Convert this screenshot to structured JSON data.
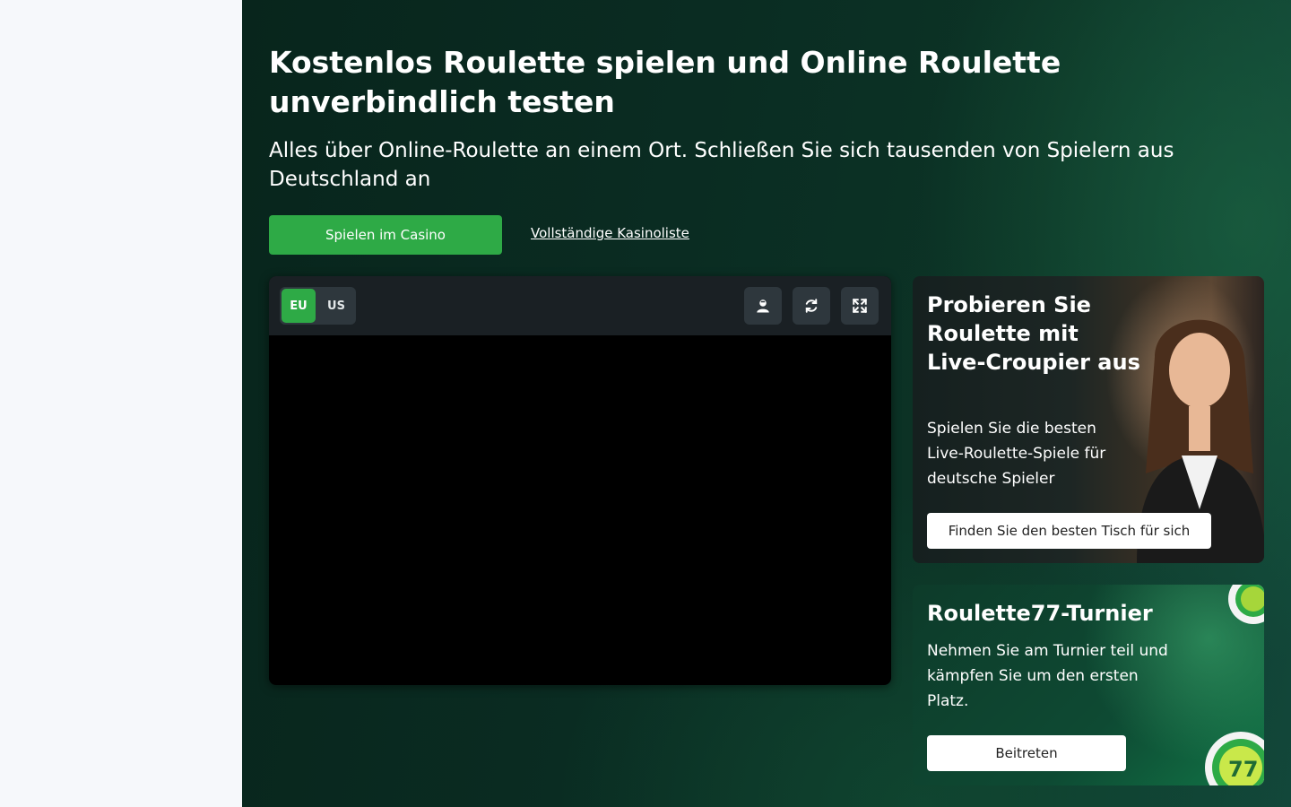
{
  "hero": {
    "title": "Kostenlos Roulette spielen und Online Roulette unverbindlich testen",
    "subtitle": "Alles über Online-Roulette an einem Ort. Schließen Sie sich tausenden von Spielern aus Deutschland an",
    "play_button": "Spielen im Casino",
    "list_link": "Vollständige Kasinoliste"
  },
  "game": {
    "toggle": {
      "eu": "EU",
      "us": "US",
      "selected": "EU"
    },
    "controls": [
      "dealer-icon",
      "refresh-icon",
      "fullscreen-icon"
    ]
  },
  "cards": {
    "live": {
      "title": "Probieren Sie Roulette mit Live-Croupier aus",
      "text": "Spielen Sie die besten Live-Roulette-Spiele für deutsche Spieler",
      "button": "Finden Sie den besten Tisch für sich"
    },
    "tournament": {
      "title": "Roulette77-Turnier",
      "text": "Nehmen Sie am Turnier teil und kämpfen Sie um den ersten Platz.",
      "button": "Beitreten"
    }
  },
  "colors": {
    "accent": "#2eaa46",
    "background_dark": "#0a2c22",
    "sidebar": "#f6f8fb"
  }
}
